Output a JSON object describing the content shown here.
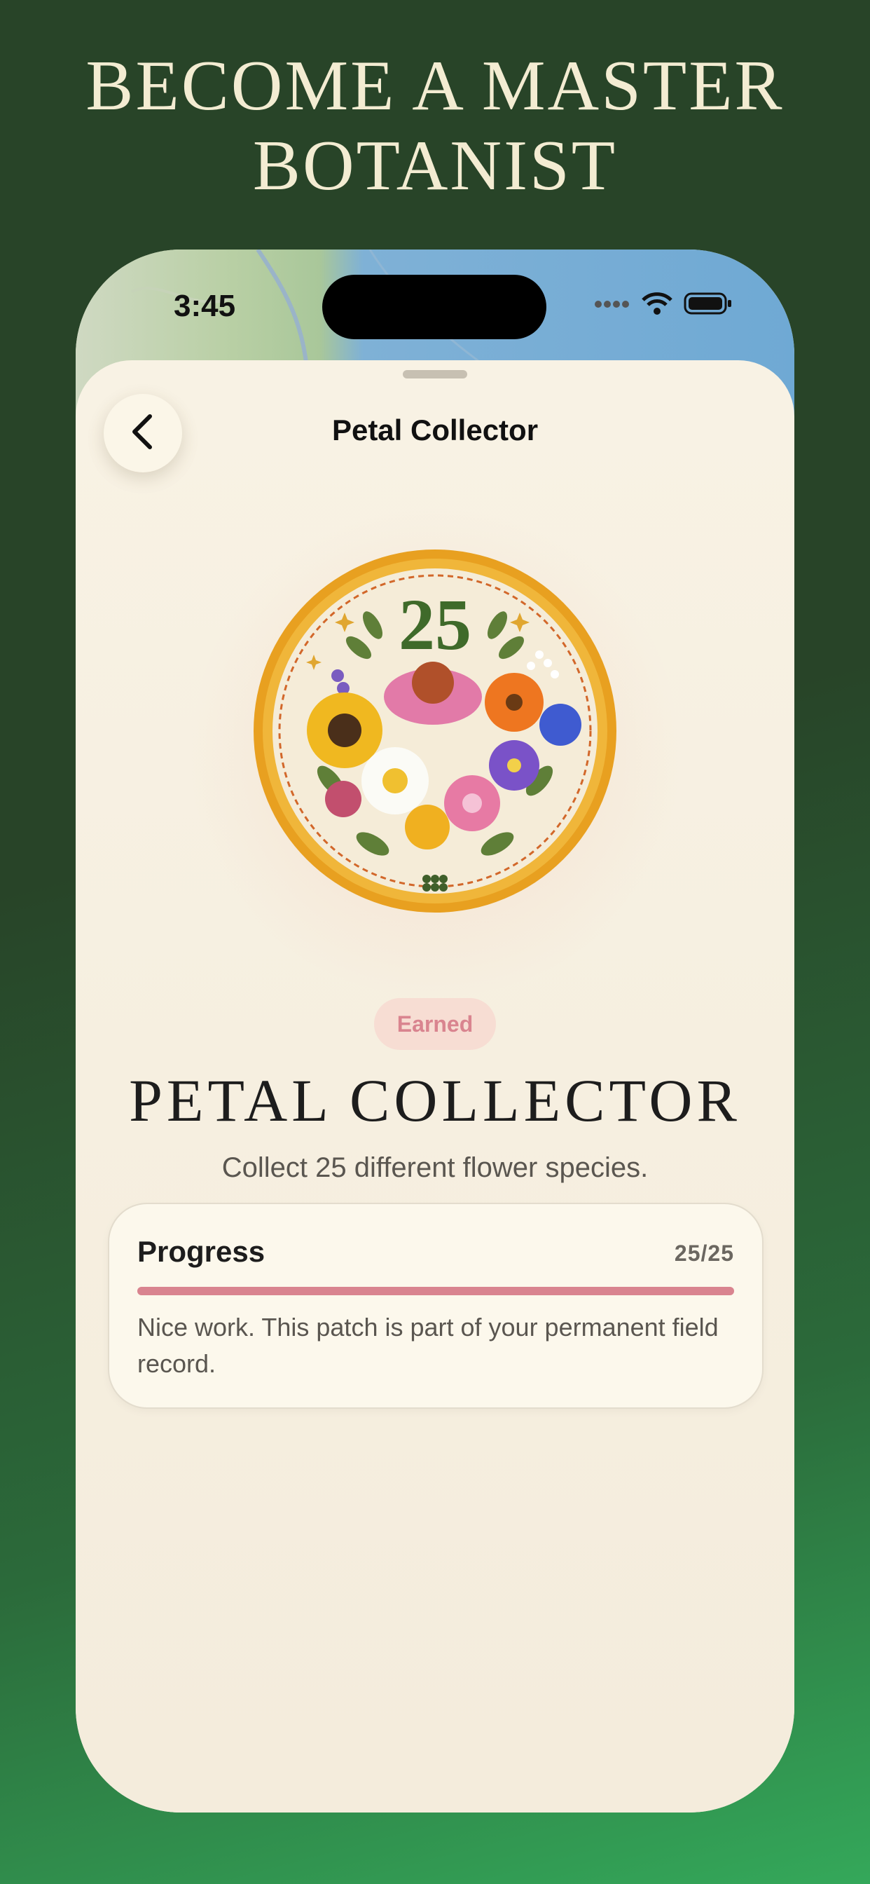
{
  "headline": "BECOME A MASTER BOTANIST",
  "status_bar": {
    "time": "3:45"
  },
  "nav": {
    "title": "Petal Collector",
    "back_icon": "chevron-left-icon"
  },
  "badge": {
    "number": "25",
    "status": "Earned"
  },
  "patch": {
    "title": "PETAL COLLECTOR",
    "description": "Collect 25 different flower species."
  },
  "progress": {
    "label": "Progress",
    "count": "25/25",
    "fraction": 1.0,
    "note": "Nice work. This patch is part of your permanent field record."
  },
  "colors": {
    "background": "#284428",
    "sheet": "#f4ecdc",
    "accent": "#d9848f",
    "badge_rim": "#e8a020"
  }
}
